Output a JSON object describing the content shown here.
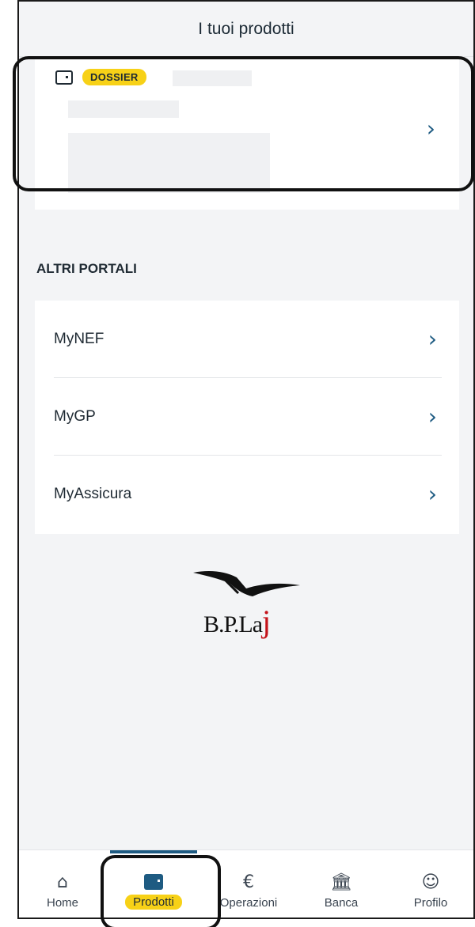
{
  "header": {
    "title": "I tuoi prodotti"
  },
  "product_card": {
    "badge": "DOSSIER",
    "icon": "wallet-icon",
    "chevron_icon": "chevron-right-icon"
  },
  "altri_portali": {
    "title": "ALTRI PORTALI",
    "items": [
      {
        "label": "MyNEF"
      },
      {
        "label": "MyGP"
      },
      {
        "label": "MyAssicura"
      }
    ]
  },
  "logo": {
    "text": "B.P.La",
    "accent": "j",
    "accent_color": "#c4121a"
  },
  "bottom_nav": {
    "items": [
      {
        "label": "Home",
        "icon": "home-icon"
      },
      {
        "label": "Prodotti",
        "icon": "wallet-icon",
        "active": true
      },
      {
        "label": "Operazioni",
        "icon": "euro-icon"
      },
      {
        "label": "Banca",
        "icon": "bank-icon"
      },
      {
        "label": "Profilo",
        "icon": "profile-icon"
      }
    ]
  },
  "colors": {
    "accent": "#1e5b82",
    "badge": "#f7d117",
    "background": "#f3f4f6"
  }
}
